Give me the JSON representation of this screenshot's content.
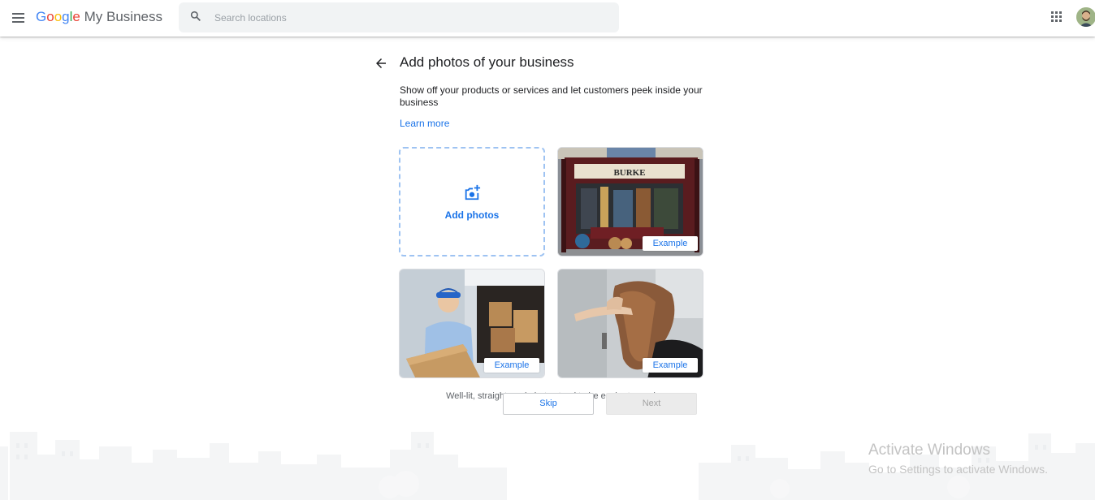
{
  "header": {
    "brand_google": [
      "G",
      "o",
      "o",
      "g",
      "l",
      "e"
    ],
    "brand_suffix": "My Business",
    "search_placeholder": "Search locations",
    "menu_icon": "hamburger-menu-icon",
    "apps_icon": "apps-grid-icon",
    "avatar": "user-avatar"
  },
  "page": {
    "title": "Add photos of your business",
    "description": "Show off your products or services and let customers peek inside your business",
    "learn_more": "Learn more",
    "add_photos_label": "Add photos",
    "examples": [
      {
        "badge": "Example"
      },
      {
        "badge": "Example"
      },
      {
        "badge": "Example"
      }
    ],
    "hint": "Well-lit, straightened photos tend to be easier to read",
    "skip_label": "Skip",
    "next_label": "Next"
  },
  "watermark": {
    "title": "Activate Windows",
    "subtitle": "Go to Settings to activate Windows."
  },
  "colors": {
    "accent": "#1a73e8",
    "dashed_border": "#9ec3f2",
    "disabled_bg": "#ebebeb"
  }
}
